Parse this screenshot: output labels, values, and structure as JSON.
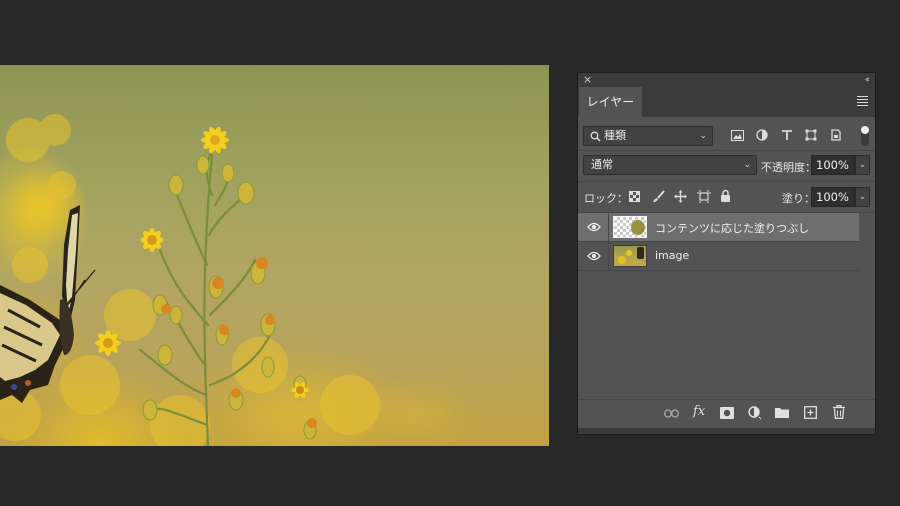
{
  "panel": {
    "tab_label": "レイヤー",
    "close_glyph": "×",
    "collapse_glyph": "‹‹"
  },
  "filter": {
    "label": "種類",
    "icons": [
      "image-filter-icon",
      "adjustment-filter-icon",
      "type-filter-icon",
      "shape-filter-icon",
      "smart-object-filter-icon"
    ]
  },
  "blend": {
    "mode": "通常",
    "opacity_label": "不透明度：",
    "opacity_value": "100%"
  },
  "lock": {
    "label": "ロック：",
    "icons": [
      "lock-transparent-pixels-icon",
      "lock-image-pixels-icon",
      "lock-position-icon",
      "lock-artboard-icon",
      "lock-all-icon"
    ],
    "fill_label": "塗り：",
    "fill_value": "100%"
  },
  "layers": [
    {
      "name": "コンテンツに応じた塗りつぶし",
      "visible": true,
      "selected": true
    },
    {
      "name": "image",
      "visible": true,
      "selected": false
    }
  ],
  "footer": {
    "icons": [
      "link-layers-icon",
      "layer-style-icon",
      "add-mask-icon",
      "adjustment-layer-icon",
      "new-group-icon",
      "new-layer-icon",
      "delete-layer-icon"
    ],
    "fx_label": "fx"
  },
  "colors": {
    "app_background": "#282828",
    "panel_background": "#535353",
    "selected_layer": "#6e6e6e"
  }
}
